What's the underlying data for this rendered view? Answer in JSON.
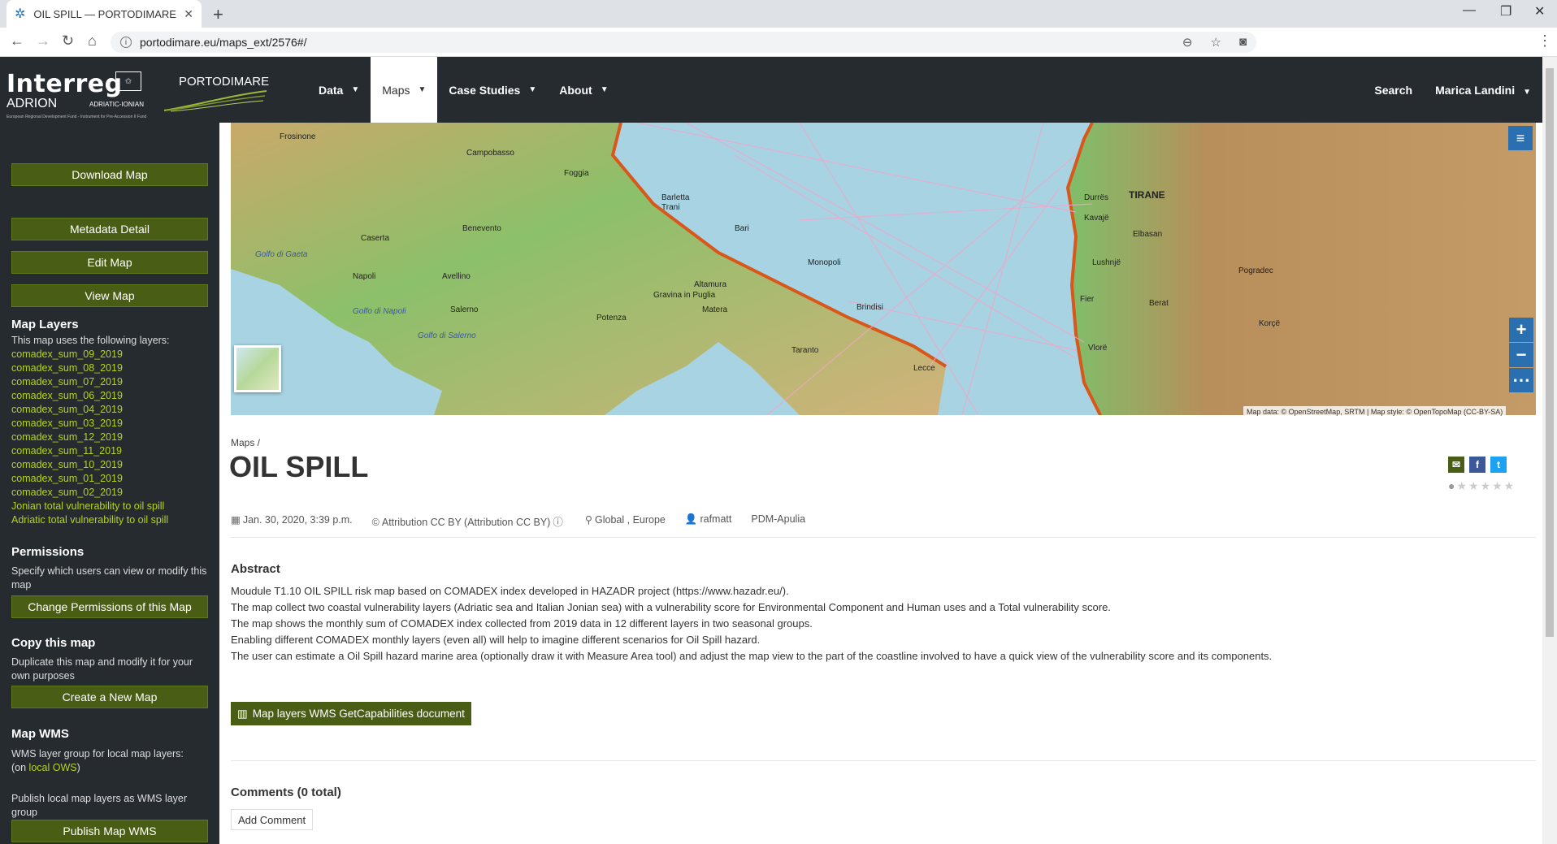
{
  "browser": {
    "tab_title": "OIL SPILL — PORTODIMARE",
    "url": "portodimare.eu/maps_ext/2576#/"
  },
  "header": {
    "logo_line1": "Interreg",
    "logo_line2": "ADRION",
    "logo_line3": "ADRIATIC-IONIAN",
    "logo_fund": "European Regional Development Fund - Instrument for Pre-Accession II Fund",
    "brand": "PORTODIMARE",
    "nav": [
      {
        "label": "Data"
      },
      {
        "label": "Maps"
      },
      {
        "label": "Case Studies"
      },
      {
        "label": "About"
      }
    ],
    "search_label": "Search",
    "user_label": "Marica Landini"
  },
  "sidebar": {
    "download_map": "Download Map",
    "metadata_detail": "Metadata Detail",
    "edit_map": "Edit Map",
    "view_map": "View Map",
    "layers_heading": "Map Layers",
    "layers_intro": "This map uses the following layers:",
    "layers": [
      "comadex_sum_09_2019",
      "comadex_sum_08_2019",
      "comadex_sum_07_2019",
      "comadex_sum_06_2019",
      "comadex_sum_04_2019",
      "comadex_sum_03_2019",
      "comadex_sum_12_2019",
      "comadex_sum_11_2019",
      "comadex_sum_10_2019",
      "comadex_sum_01_2019",
      "comadex_sum_02_2019",
      "Jonian total vulnerability to oil spill",
      "Adriatic total vulnerability to oil spill"
    ],
    "permissions_heading": "Permissions",
    "permissions_text": "Specify which users can view or modify this map",
    "change_permissions": "Change Permissions of this Map",
    "copy_heading": "Copy this map",
    "copy_text": "Duplicate this map and modify it for your own purposes",
    "create_new_map": "Create a New Map",
    "wms_heading": "Map WMS",
    "wms_group_text": "WMS layer group for local map layers:",
    "wms_on": "(on ",
    "wms_link": "local OWS",
    "wms_close": ")",
    "wms_publish_text": "Publish local map layers as WMS layer group",
    "publish_map_wms": "Publish Map WMS"
  },
  "map": {
    "attribution": "Map data: © OpenStreetMap, SRTM | Map style: © OpenTopoMap (CC-BY-SA)",
    "labels": [
      "Campobasso",
      "Foggia",
      "Barletta",
      "Trani",
      "Bari",
      "Benevento",
      "Caserta",
      "Napoli",
      "Avellino",
      "Salerno",
      "Potenza",
      "Matera",
      "Taranto",
      "Lecce",
      "Golfo di Gaeta",
      "Golfo di Napoli",
      "Golfo di Salerno",
      "Frosinone",
      "Durrës",
      "TIRANE",
      "Elbasan",
      "Lushnjë",
      "Fier",
      "Berat",
      "Vlorë",
      "Korçë",
      "Pogradec",
      "Kavajë",
      "Gravina in Puglia",
      "Altamura",
      "Monopoli",
      "Brindisi"
    ]
  },
  "main": {
    "breadcrumb": "Maps /",
    "title": "OIL SPILL",
    "meta": {
      "date": "Jan. 30, 2020, 3:39 p.m.",
      "license": "Attribution CC BY (Attribution CC BY)",
      "region": "Global , Europe",
      "owner": "rafmatt",
      "group": "PDM-Apulia"
    },
    "abstract_heading": "Abstract",
    "abstract_lines": [
      "Moudule T1.10 OIL SPILL risk map based on COMADEX index developed in HAZADR project (https://www.hazadr.eu/).",
      "The map collect two coastal vulnerability layers (Adriatic sea and Italian Jonian sea) with a vulnerability score for Environmental Component and Human uses and a Total vulnerability score.",
      "The map shows the monthly sum of COMADEX index collected from 2019 data in 12 different layers in two seasonal groups.",
      "Enabling different COMADEX monthly layers (even all) will help to imagine different scenarios for Oil Spill hazard.",
      "The user can estimate a Oil Spill hazard marine area (optionally draw it with Measure Area tool) and adjust the map view to the part of the coastline involved to have a quick view of the vulnerability score and its components."
    ],
    "wms_button": "Map layers WMS GetCapabilities document",
    "comments_heading": "Comments (0 total)",
    "add_comment": "Add Comment"
  },
  "colors": {
    "header_bg": "#262b30",
    "sidebar_btn": "#4a5d14",
    "link_green": "#b4d41a",
    "map_control": "#2a6fb0"
  }
}
